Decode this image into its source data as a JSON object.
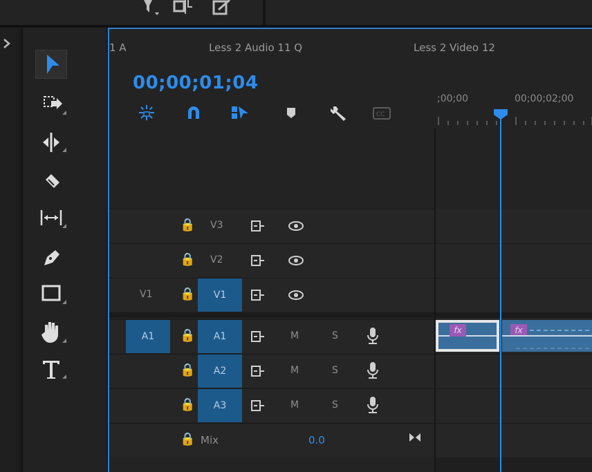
{
  "tabs": [
    {
      "label": "1 A"
    },
    {
      "label": "Less 2 Audio 11 Q"
    },
    {
      "label": "Less 2 Video 12"
    }
  ],
  "timecode": "00;00;01;04",
  "ruler": {
    "start": ";00;00",
    "mark": "00;00;02;00"
  },
  "video_tracks": [
    {
      "lock": "🔒",
      "name": "V3",
      "source": "",
      "active": false
    },
    {
      "lock": "🔒",
      "name": "V2",
      "source": "",
      "active": false
    },
    {
      "lock": "🔒",
      "name": "V1",
      "source": "V1",
      "active": true
    }
  ],
  "audio_tracks": [
    {
      "name": "A1",
      "source": "A1",
      "mute": "M",
      "solo": "S"
    },
    {
      "name": "A2",
      "source": "",
      "mute": "M",
      "solo": "S"
    },
    {
      "name": "A3",
      "source": "",
      "mute": "M",
      "solo": "S"
    }
  ],
  "mix": {
    "label": "Mix",
    "value": "0.0"
  },
  "clips": [
    {
      "badge": "fx"
    },
    {
      "badge": "fx"
    }
  ],
  "colors": {
    "accent": "#2d8ceb",
    "track_target": "#1c5a8c",
    "clip_audio": "#3a6e9c",
    "fx_badge": "#9b59b6"
  },
  "icons": {
    "tools": [
      "selection-tool-icon",
      "track-select-forward-icon",
      "ripple-edit-icon",
      "razor-icon",
      "slip-icon",
      "pen-icon",
      "rectangle-icon",
      "hand-icon",
      "type-icon"
    ],
    "header": [
      "nest-toggle-icon",
      "snap-magnet-icon",
      "linked-selection-icon",
      "add-marker-icon",
      "timeline-settings-wrench-icon",
      "captions-icon"
    ]
  }
}
